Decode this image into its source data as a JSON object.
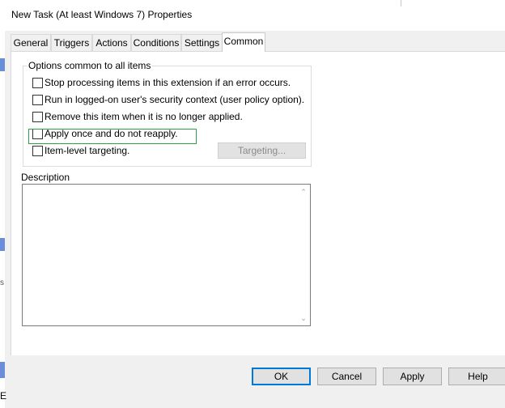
{
  "window": {
    "title": "New Task (At least Windows 7) Properties"
  },
  "tabs": [
    {
      "label": "General"
    },
    {
      "label": "Triggers"
    },
    {
      "label": "Actions"
    },
    {
      "label": "Conditions"
    },
    {
      "label": "Settings"
    },
    {
      "label": "Common",
      "active": true
    }
  ],
  "options_group": {
    "legend": "Options common to all items",
    "checkboxes": [
      {
        "label": "Stop processing items in this extension if an error occurs.",
        "checked": false
      },
      {
        "label": "Run in logged-on user's security context (user policy option).",
        "checked": false
      },
      {
        "label": "Remove this item when it is no longer applied.",
        "checked": false
      },
      {
        "label": "Apply once and do not reapply.",
        "checked": false
      },
      {
        "label": "Item-level targeting.",
        "checked": false
      }
    ],
    "targeting_button": "Targeting..."
  },
  "description": {
    "label": "Description",
    "value": ""
  },
  "buttons": {
    "ok": "OK",
    "cancel": "Cancel",
    "apply": "Apply",
    "help": "Help"
  },
  "background_window": {
    "text1": "s",
    "text2": "E"
  },
  "colors": {
    "highlight": "#2ea043",
    "default_button_border": "#0078d7"
  }
}
